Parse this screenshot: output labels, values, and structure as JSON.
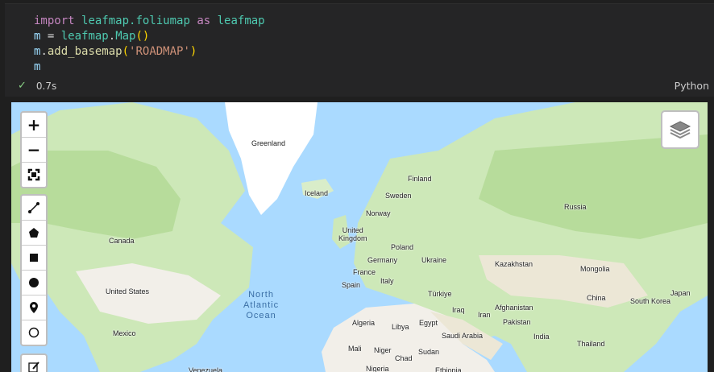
{
  "code_lines": {
    "l1": {
      "kw1": "import",
      "mod": "leafmap.foliumap",
      "kw2": "as",
      "alias": "leafmap"
    },
    "l2": {
      "var": "m",
      "eq": " = ",
      "obj": "leafmap",
      "fn": "Map",
      "open": "(",
      "close": ")"
    },
    "l3": {
      "var": "m",
      "fn": "add_basemap",
      "open": "(",
      "arg": "'ROADMAP'",
      "close": ")"
    },
    "l4": {
      "var": "m"
    }
  },
  "status": {
    "time": "0.7s",
    "language": "Python"
  },
  "map": {
    "controls": {
      "zoom_in": "+",
      "zoom_out": "−"
    },
    "labels": [
      {
        "text": "Greenland"
      },
      {
        "text": "Iceland"
      },
      {
        "text": "Finland"
      },
      {
        "text": "Sweden"
      },
      {
        "text": "Norway"
      },
      {
        "text": "Russia"
      },
      {
        "text": "United\nKingdom"
      },
      {
        "text": "Poland"
      },
      {
        "text": "Canada"
      },
      {
        "text": "Germany"
      },
      {
        "text": "Ukraine"
      },
      {
        "text": "Kazakhstan"
      },
      {
        "text": "France"
      },
      {
        "text": "Mongolia"
      },
      {
        "text": "Italy"
      },
      {
        "text": "Spain"
      },
      {
        "text": "United States"
      },
      {
        "text": "Türkiye"
      },
      {
        "text": "China"
      },
      {
        "text": "Japan"
      },
      {
        "text": "Iraq"
      },
      {
        "text": "Afghanistan"
      },
      {
        "text": "South Korea"
      },
      {
        "text": "Iran"
      },
      {
        "text": "Algeria"
      },
      {
        "text": "Libya"
      },
      {
        "text": "Egypt"
      },
      {
        "text": "Pakistan"
      },
      {
        "text": "Mexico"
      },
      {
        "text": "Saudi Arabia"
      },
      {
        "text": "India"
      },
      {
        "text": "Thailand"
      },
      {
        "text": "Mali"
      },
      {
        "text": "Niger"
      },
      {
        "text": "Sudan"
      },
      {
        "text": "Chad"
      },
      {
        "text": "Nigeria"
      },
      {
        "text": "Ethiopia"
      },
      {
        "text": "Venezuela"
      }
    ],
    "ocean": {
      "line1": "North",
      "line2": "Atlantic",
      "line3": "Ocean"
    }
  }
}
